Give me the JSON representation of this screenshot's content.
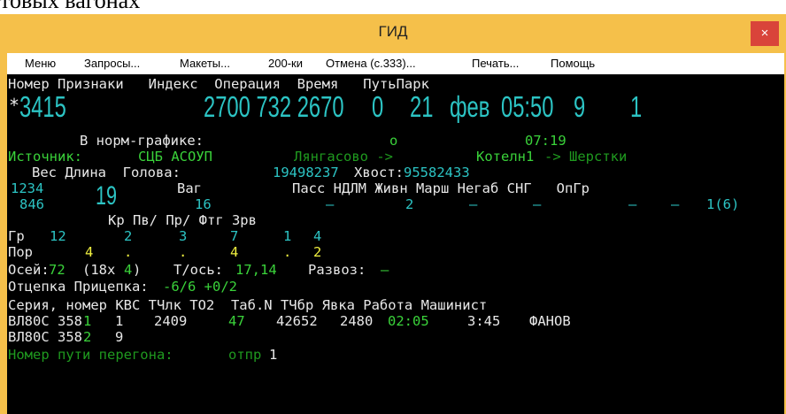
{
  "cropped_caption": "товых вагонах",
  "window": {
    "title": "ГИД",
    "close": "×"
  },
  "menu": [
    "Меню",
    "Запросы...",
    "Макеты...",
    "200-ки",
    "Отмена (с.333)...",
    "Печать...",
    "Помощь"
  ],
  "terminal": {
    "header1": "Номер Признаки   Индекс  Операция  Время   ПутьПарк",
    "train": {
      "star": "*",
      "number": "3415",
      "index": "2700 732 2670",
      "op_code": "0",
      "day": "21",
      "month": "фев",
      "time": "05:50",
      "track": "9",
      "park": "1"
    },
    "schedule_label": "В норм-графике:",
    "schedule_mark": "о",
    "schedule_time": "07:19",
    "source_label": "Источник:",
    "source_value": "СЦБ АСОУП",
    "route_from": "Лянгасово ->",
    "route_mid": "Котелн1",
    "route_to": "-> Шерстки",
    "weight_header": "Вес Длина  Голова:",
    "head_value": "19498237",
    "tail_label": "Хвост:",
    "tail_value": "95582433",
    "weight": "1234",
    "length": "19",
    "wag_label": "Ваг",
    "cat_header": "Пасс НДЛМ Живн Марш Негаб СНГ   ОпГр",
    "weight2": "846",
    "wagons": "16",
    "cat_values": [
      "–",
      "2",
      "–",
      "–",
      "–",
      "–",
      "1(6)"
    ],
    "grp_header": "Кр Пв/ Пр/ Фтг Зрв",
    "gr_label": "Гр",
    "gr_values": [
      "12",
      "2",
      "3",
      "7",
      "1",
      "4"
    ],
    "por_label": "Пор",
    "por_values": [
      "4",
      ".",
      ".",
      "4",
      ".",
      "2"
    ],
    "axles_label": "Осей:",
    "axles": "72",
    "axles_mult": "(18x",
    "axles_four": "4",
    "axles_close": ")",
    "load_label": "Т/ось:",
    "load": "17,14",
    "razvoz_label": "Развоз:",
    "razvoz": "–",
    "otcep_label": "Отцепка Прицепка:",
    "otcep_value": "-6/6 +0/2",
    "loco_header": "Серия, номер КВС ТЧлк ТО2  Таб.N ТЧбр Явка Работа Машинист",
    "loco1": {
      "series": "ВЛ80С 358",
      "digit": "1",
      "kvs": "1",
      "tchlk": "2409",
      "to2": "47",
      "tab": "42652",
      "tchbr": "2480",
      "yavka": "02:05",
      "work": "3:45",
      "driver": "ФАНОВ"
    },
    "loco2": {
      "series": "ВЛ80С 358",
      "digit": "2",
      "kvs": "9"
    },
    "path_label": "Номер пути перегона:",
    "path_otpr": "отпр",
    "path_value": "1"
  }
}
